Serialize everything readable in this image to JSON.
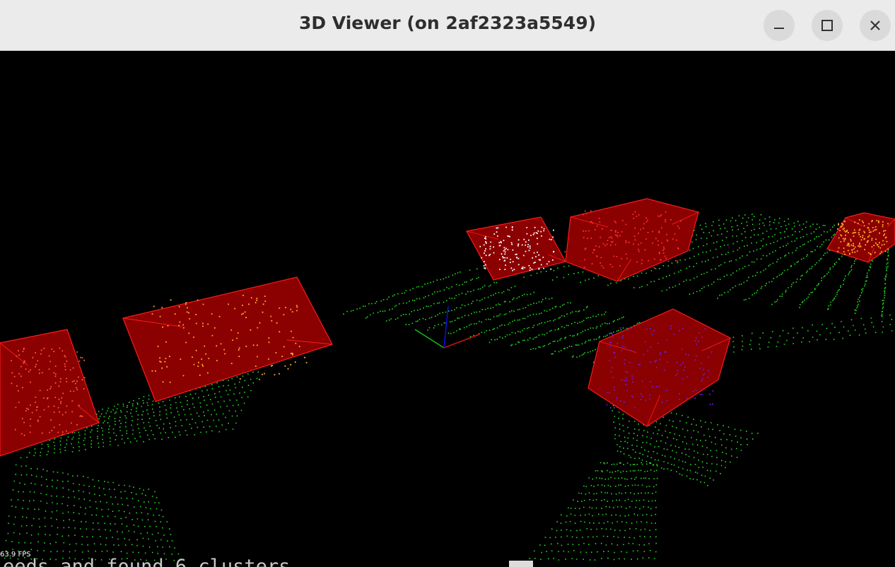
{
  "window": {
    "title": "3D Viewer (on 2af2323a5549)",
    "controls": [
      "minimize-icon",
      "maximize-icon",
      "close-icon"
    ]
  },
  "viewer": {
    "fps_label": "63.9 FPS",
    "background_color": "#000000",
    "ground_point_color": "#22dd22",
    "box_fill_color": "#8b0000",
    "box_edge_color": "#ff1a1a",
    "axes_colors": {
      "x": "#d01010",
      "y": "#10c010",
      "z": "#1010e0"
    },
    "clusters": [
      {
        "id": 1,
        "point_color": "#ff5a3c"
      },
      {
        "id": 2,
        "point_color": "#ffb030"
      },
      {
        "id": 3,
        "point_color": "#ffffff"
      },
      {
        "id": 4,
        "point_color": "#ff3030"
      },
      {
        "id": 5,
        "point_color": "#ffb030"
      },
      {
        "id": 6,
        "point_color": "#6a20d0"
      }
    ]
  },
  "console": {
    "visible_text": "eeds and found 6 clusters"
  }
}
